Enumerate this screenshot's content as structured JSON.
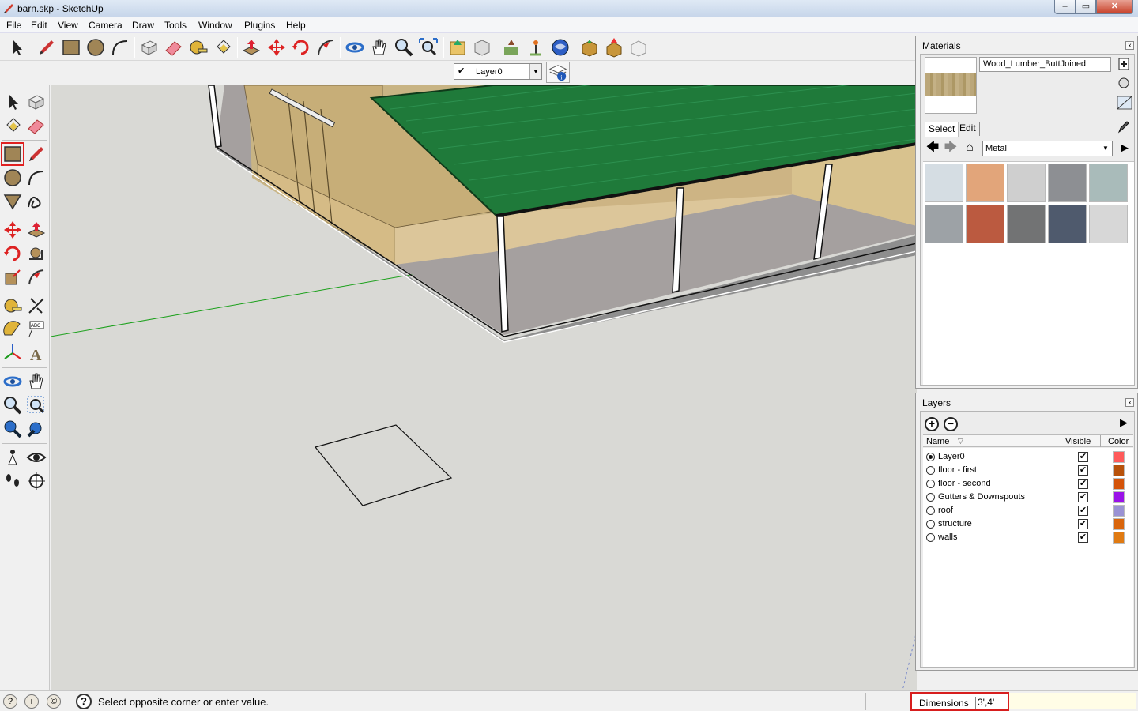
{
  "window": {
    "title": "barn.skp - SketchUp",
    "controls": {
      "minimize": "–",
      "maximize": "▭",
      "close": "✕"
    }
  },
  "menu": [
    "File",
    "Edit",
    "View",
    "Camera",
    "Draw",
    "Tools",
    "Window",
    "Plugins",
    "Help"
  ],
  "layer_toolbar": {
    "current_layer": "Layer0",
    "check": "✔"
  },
  "materials": {
    "title": "Materials",
    "current_material": "Wood_Lumber_ButtJoined",
    "tabs": [
      "Select",
      "Edit"
    ],
    "active_tab": "Select",
    "library": "Metal",
    "nav": {
      "back": "🡄",
      "forward": "🡆",
      "home": "⌂",
      "details": "▶"
    },
    "swatch_colors": [
      "#d5dde3",
      "#e2a57a",
      "#cfcfcf",
      "#8d8f93",
      "#a9bbba",
      "#9da2a6",
      "#bb5a40",
      "#727374",
      "#4f5a6d",
      "#d7d7d7"
    ]
  },
  "layers": {
    "title": "Layers",
    "add": "+",
    "remove": "−",
    "columns": {
      "name": "Name",
      "visible": "Visible",
      "color": "Color"
    },
    "items": [
      {
        "name": "Layer0",
        "active": true,
        "visible": true,
        "color": "#ff5a5a"
      },
      {
        "name": "floor - first",
        "active": false,
        "visible": true,
        "color": "#b8520c"
      },
      {
        "name": "floor - second",
        "active": false,
        "visible": true,
        "color": "#d4540a"
      },
      {
        "name": "Gutters & Downspouts",
        "active": false,
        "visible": true,
        "color": "#9a12e8"
      },
      {
        "name": "roof",
        "active": false,
        "visible": true,
        "color": "#9a92d4"
      },
      {
        "name": "structure",
        "active": false,
        "visible": true,
        "color": "#d9650c"
      },
      {
        "name": "walls",
        "active": false,
        "visible": true,
        "color": "#e07a12"
      }
    ]
  },
  "status": {
    "icons": [
      "?",
      "i",
      "©"
    ],
    "help": "?",
    "message": "Select opposite corner or enter value.",
    "vcb_label": "Dimensions",
    "vcb_value": "3',4'"
  },
  "labels": {
    "close_x": "x",
    "check": "✔",
    "dropdown": "▼",
    "sort": "▽"
  }
}
